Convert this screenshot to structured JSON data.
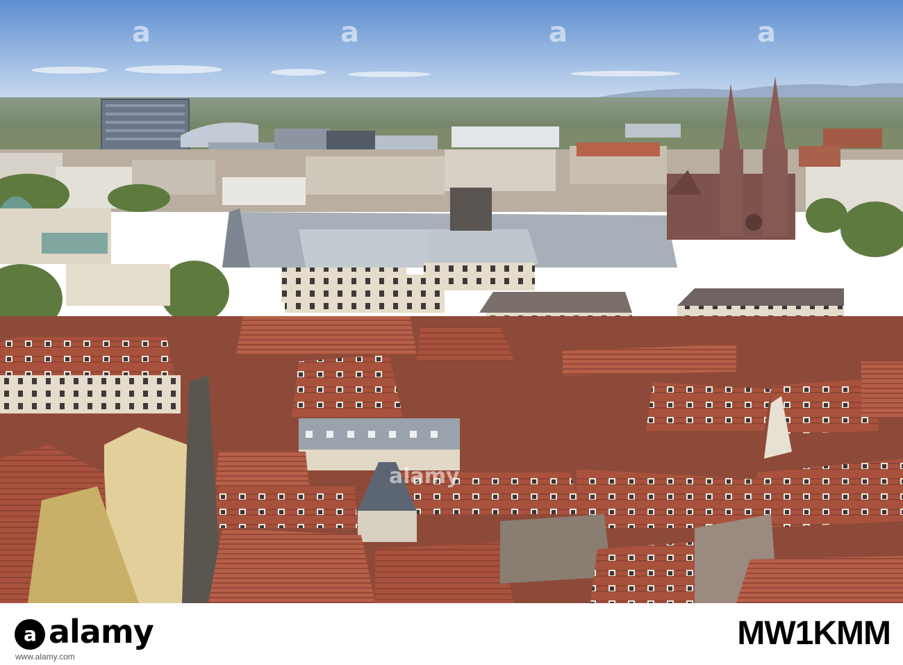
{
  "photo": {
    "subject": "aerial-cityscape",
    "colors": {
      "sky_top": "#5f8fd1",
      "sky_horizon": "#c9dbef",
      "roof_red": "#a8523e",
      "roof_dark": "#6e3a2c",
      "slate_gray": "#9aa3ad",
      "facade_cream": "#e6dccb",
      "church_stone": "#8a5a55",
      "trees": "#5f7a3f"
    }
  },
  "stock": {
    "brand": "alamy",
    "site": "www.alamy.com",
    "image_id": "MW1KMM"
  }
}
